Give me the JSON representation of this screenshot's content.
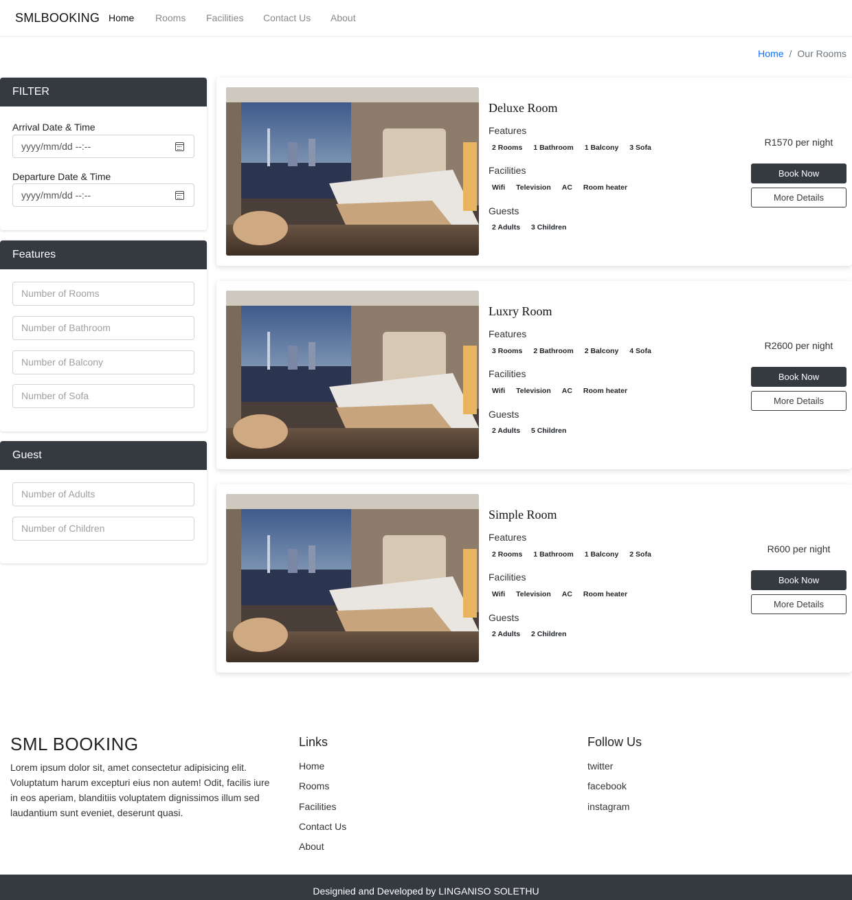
{
  "nav": {
    "brand": "SMLBOOKING",
    "links": [
      "Home",
      "Rooms",
      "Facilities",
      "Contact Us",
      "About"
    ]
  },
  "breadcrumb": {
    "home": "Home",
    "sep": "/",
    "current": "Our Rooms"
  },
  "filter": {
    "title": "FILTER",
    "arrival_label": "Arrival Date & Time",
    "arrival_placeholder": "yyyy/mm/dd --:--",
    "departure_label": "Departure Date & Time",
    "departure_placeholder": "yyyy/mm/dd --:--"
  },
  "features_panel": {
    "title": "Features",
    "placeholders": [
      "Number of Rooms",
      "Number of Bathroom",
      "Number of Balcony",
      "Number of Sofa"
    ]
  },
  "guest_panel": {
    "title": "Guest",
    "placeholders": [
      "Number of Adults",
      "Number of Children"
    ]
  },
  "rooms": [
    {
      "title": "Deluxe Room",
      "features_label": "Features",
      "features": [
        "2 Rooms",
        "1 Bathroom",
        "1 Balcony",
        "3 Sofa"
      ],
      "facilities_label": "Facilities",
      "facilities": [
        "Wifi",
        "Television",
        "AC",
        "Room heater"
      ],
      "guests_label": "Guests",
      "guests": [
        "2 Adults",
        "3 Children"
      ],
      "price": "R1570 per night",
      "book": "Book Now",
      "details": "More Details"
    },
    {
      "title": "Luxry Room",
      "features_label": "Features",
      "features": [
        "3 Rooms",
        "2 Bathroom",
        "2 Balcony",
        "4 Sofa"
      ],
      "facilities_label": "Facilities",
      "facilities": [
        "Wifi",
        "Television",
        "AC",
        "Room heater"
      ],
      "guests_label": "Guests",
      "guests": [
        "2 Adults",
        "5 Children"
      ],
      "price": "R2600 per night",
      "book": "Book Now",
      "details": "More Details"
    },
    {
      "title": "Simple Room",
      "features_label": "Features",
      "features": [
        "2 Rooms",
        "1 Bathroom",
        "1 Balcony",
        "2 Sofa"
      ],
      "facilities_label": "Facilities",
      "facilities": [
        "Wifi",
        "Television",
        "AC",
        "Room heater"
      ],
      "guests_label": "Guests",
      "guests": [
        "2 Adults",
        "2 Children"
      ],
      "price": "R600 per night",
      "book": "Book Now",
      "details": "More Details"
    }
  ],
  "footer": {
    "title": "SML BOOKING",
    "text": "Lorem ipsum dolor sit, amet consectetur adipisicing elit. Voluptatum harum excepturi eius non autem! Odit, facilis iure in eos aperiam, blanditiis voluptatem dignissimos illum sed laudantium sunt eveniet, deserunt quasi.",
    "links_heading": "Links",
    "links": [
      "Home",
      "Rooms",
      "Facilities",
      "Contact Us",
      "About"
    ],
    "follow_heading": "Follow Us",
    "follow": [
      "twitter",
      "facebook",
      "instagram"
    ],
    "credit": "Designied and Developed by LINGANISO SOLETHU"
  },
  "colors": {
    "dark": "#343a40",
    "link": "#0d6efd"
  }
}
